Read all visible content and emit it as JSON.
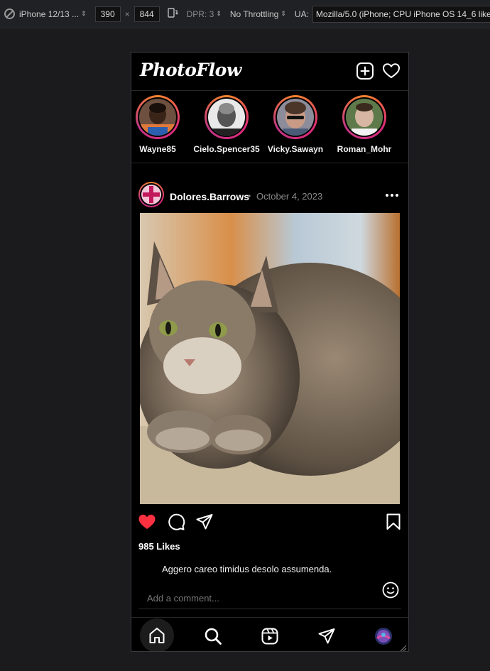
{
  "devtools": {
    "device": "iPhone 12/13 ...",
    "width": "390",
    "x_sep": "×",
    "height": "844",
    "dpr": "DPR: 3",
    "throttling": "No Throttling",
    "ua_label": "UA:",
    "ua_value": "Mozilla/5.0 (iPhone; CPU iPhone OS 14_6 like M"
  },
  "app": {
    "logo": "PhotoFlow",
    "top_icons": [
      "add-post-icon",
      "heart-icon"
    ]
  },
  "stories": [
    {
      "name": "Wayne85"
    },
    {
      "name": "Cielo.Spencer35"
    },
    {
      "name": "Vicky.Sawayn"
    },
    {
      "name": "Roman_Mohr"
    }
  ],
  "post": {
    "username": "Dolores.Barrows",
    "dot": "•",
    "date": "October 4, 2023",
    "likes": "985 Likes",
    "liked": true,
    "caption": "Aggero careo timidus desolo assumenda.",
    "comment_placeholder": "Add a comment..."
  },
  "nav": {
    "items": [
      "home-icon",
      "search-icon",
      "reels-icon",
      "send-icon",
      "profile-avatar"
    ],
    "active": "home-icon"
  },
  "colors": {
    "like_red": "#ff3040",
    "story_ring_start": "#f58529",
    "story_ring_end": "#c13584"
  }
}
